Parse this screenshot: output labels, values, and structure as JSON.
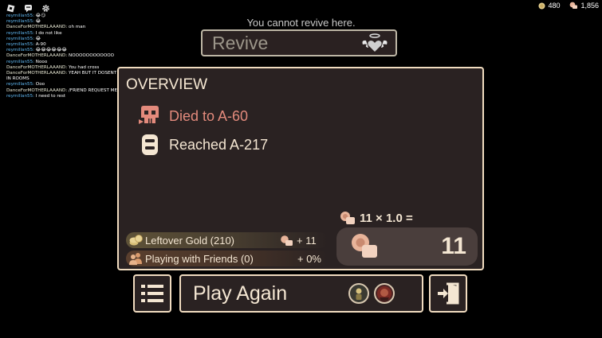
{
  "roblox_menu": {
    "icons": [
      "roblox-logo-icon",
      "chat-icon",
      "settings-gear-icon"
    ]
  },
  "chat": {
    "messages": [
      {
        "name": "reymillan55:",
        "text": "😂😏",
        "style": "blue"
      },
      {
        "name": "reymillan55:",
        "text": "😂",
        "style": "blue"
      },
      {
        "name": "DanceForMOTHERLAAAND:",
        "text": "oh man",
        "style": "alt"
      },
      {
        "name": "reymillan55:",
        "text": "I do not like",
        "style": "blue"
      },
      {
        "name": "reymillan55:",
        "text": "😂",
        "style": "blue"
      },
      {
        "name": "reymillan55:",
        "text": "A-90",
        "style": "blue"
      },
      {
        "name": "reymillan55:",
        "text": "😂😂😂😂😂😂",
        "style": "blue"
      },
      {
        "name": "DanceForMOTHERLAAAND:",
        "text": "NOOOOOOOOOOOO",
        "style": "alt"
      },
      {
        "name": "reymillan55:",
        "text": "Nooo",
        "style": "blue"
      },
      {
        "name": "DanceForMOTHERLAAAND:",
        "text": "You had cross",
        "style": "alt"
      },
      {
        "name": "DanceForMOTHERLAAAND:",
        "text": "YEAH BUT IT DOSENT WORK IN ROOMS",
        "style": "alt"
      },
      {
        "name": "reymillan55:",
        "text": "Ooo",
        "style": "blue"
      },
      {
        "name": "DanceForMOTHERLAAAND:",
        "text": "/FRIEND REQUEST ME",
        "style": "alt"
      },
      {
        "name": "reymillan55:",
        "text": "I need to rest",
        "style": "blue"
      }
    ]
  },
  "currency": {
    "coins": "480",
    "knobs": "1,856"
  },
  "revive": {
    "note": "You cannot revive here.",
    "label": "Revive"
  },
  "overview": {
    "title": "OVERVIEW",
    "death": "Died to A-60",
    "reached": "Reached A-217",
    "bonus_gold": {
      "label": "Leftover Gold (210)",
      "amount": "+ 11"
    },
    "bonus_friends": {
      "label": "Playing with Friends (0)",
      "amount": "+ 0%"
    },
    "calc": "11 × 1.0 =",
    "total": "11"
  },
  "actions": {
    "play_again": "Play Again"
  },
  "colors": {
    "panel_bg": "#2a2222",
    "panel_border": "#f1dcc0",
    "death_text": "#e38a7c",
    "chat_name": "#60b8f2",
    "knob_color": "#e8b49a"
  }
}
